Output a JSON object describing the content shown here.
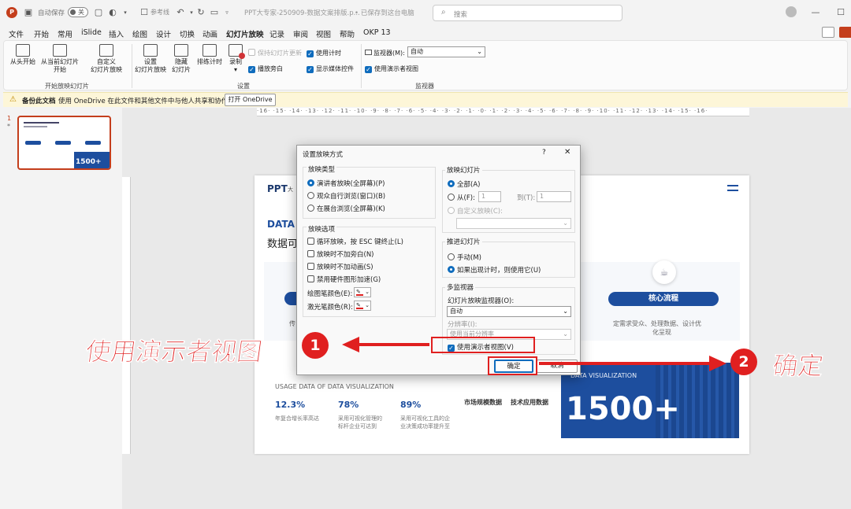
{
  "titlebar": {
    "autosave_label": "自动保存",
    "autosave_state": "关",
    "ref_mode": "参考线",
    "doc_title": "PPT大专家-250909-数据文案排版.p...",
    "save_status": "• 已保存到这台电脑",
    "search_placeholder": "搜索"
  },
  "menu": {
    "items": [
      "文件",
      "开始",
      "常用",
      "iSlide",
      "插入",
      "绘图",
      "设计",
      "切换",
      "动画",
      "幻灯片放映",
      "记录",
      "审阅",
      "视图",
      "帮助",
      "OKP 13"
    ],
    "active": "幻灯片放映"
  },
  "ribbon": {
    "from_start": "从头开始",
    "from_current_1": "从当前幻灯片",
    "from_current_2": "开始",
    "custom_1": "自定义",
    "custom_2": "幻灯片放映",
    "setup_1": "设置",
    "setup_2": "幻灯片放映",
    "hide_1": "隐藏",
    "hide_2": "幻灯片",
    "rehearse": "排练计时",
    "record": "录制",
    "keep_updated": "保持幻灯片更新",
    "play_narration": "播放旁白",
    "use_timing": "使用计时",
    "show_media": "显示媒体控件",
    "monitor_label": "监视器(M):",
    "monitor_value": "自动",
    "presenter_view": "使用演示者视图",
    "group_start": "开始放映幻灯片",
    "group_setup": "设置",
    "group_monitor": "监视器"
  },
  "notice": {
    "title": "备份此文档",
    "message": "使用 OneDrive 在此文件和其他文件中与他人共享和协作。",
    "button": "打开 OneDrive"
  },
  "thumbnail": {
    "number": "1",
    "star": "*",
    "big_text": "1500+"
  },
  "ruler": {
    "h": "·16·  ·15·  ·14·  ·13·  ·12·  ·11·  ·10·  ·9·  ·8·  ·7·  ·6·  ·5·  ·4·  ·3·  ·2·  ·1·  ·0·  ·1·  ·2·  ·3·  ·4·  ·5·  ·6·  ·7·  ·8·  ·9·  ·10·  ·11·  ·12·  ·13·  ·14·  ·15·  ·16·"
  },
  "slide": {
    "logo": "PPT",
    "logo_sub": "大",
    "data_title": "DATA",
    "cn_title": "数据可视",
    "left_text": "传",
    "pill_label": "核心流程",
    "pill_desc_1": "定需求受众、处理数据、设计优",
    "pill_desc_2": "化呈现",
    "usage_title": "USAGE DATA OF DATA VISUALIZATION",
    "stats": [
      {
        "value": "12.3%",
        "desc_1": "年复合增长率高达",
        "desc_2": ""
      },
      {
        "value": "78%",
        "desc_1": "采用可视化管理的",
        "desc_2": "标杆企业可达到"
      },
      {
        "value": "89%",
        "desc_1": "采用可视化工具的企",
        "desc_2": "业决策成功率提升至"
      }
    ],
    "tag_1": "市场规模数据",
    "tag_2": "技术应用数据",
    "vis_label": "DATA VISUALIZATION",
    "vis_big": "1500+"
  },
  "dialog": {
    "title": "设置放映方式",
    "help": "?",
    "close": "✕",
    "show_type_label": "放映类型",
    "show_types": [
      "演讲者放映(全屏幕)(P)",
      "观众自行浏览(窗口)(B)",
      "在展台浏览(全屏幕)(K)"
    ],
    "options_label": "放映选项",
    "options": [
      "循环放映，按 ESC 键终止(L)",
      "放映时不加旁白(N)",
      "放映时不加动画(S)",
      "禁用硬件图形加速(G)"
    ],
    "pen_color": "绘图笔颜色(E):",
    "laser_color": "激光笔颜色(R):",
    "slides_label": "放映幻灯片",
    "all": "全部(A)",
    "from": "从(F):",
    "from_value": "1",
    "to": "到(T):",
    "to_value": "1",
    "custom_show": "自定义放映(C):",
    "advance_label": "推进幻灯片",
    "manual": "手动(M)",
    "use_timing": "如果出现计时，则使用它(U)",
    "multi_monitor": "多监视器",
    "monitor_label": "幻灯片放映监视器(O):",
    "monitor_value": "自动",
    "resolution_label": "分辨率(I):",
    "resolution_value": "使用当前分辨率",
    "presenter_view": "使用演示者视图(V)",
    "ok": "确定",
    "cancel": "取消"
  },
  "annotations": {
    "left_text": "使用演示者视图",
    "num_1": "1",
    "num_2": "2",
    "right_text": "确定"
  },
  "colors": {
    "accent": "#c43e1c",
    "blue": "#0f6cbd",
    "slide_blue": "#1d4e9e",
    "annotation_red": "#e02020"
  }
}
